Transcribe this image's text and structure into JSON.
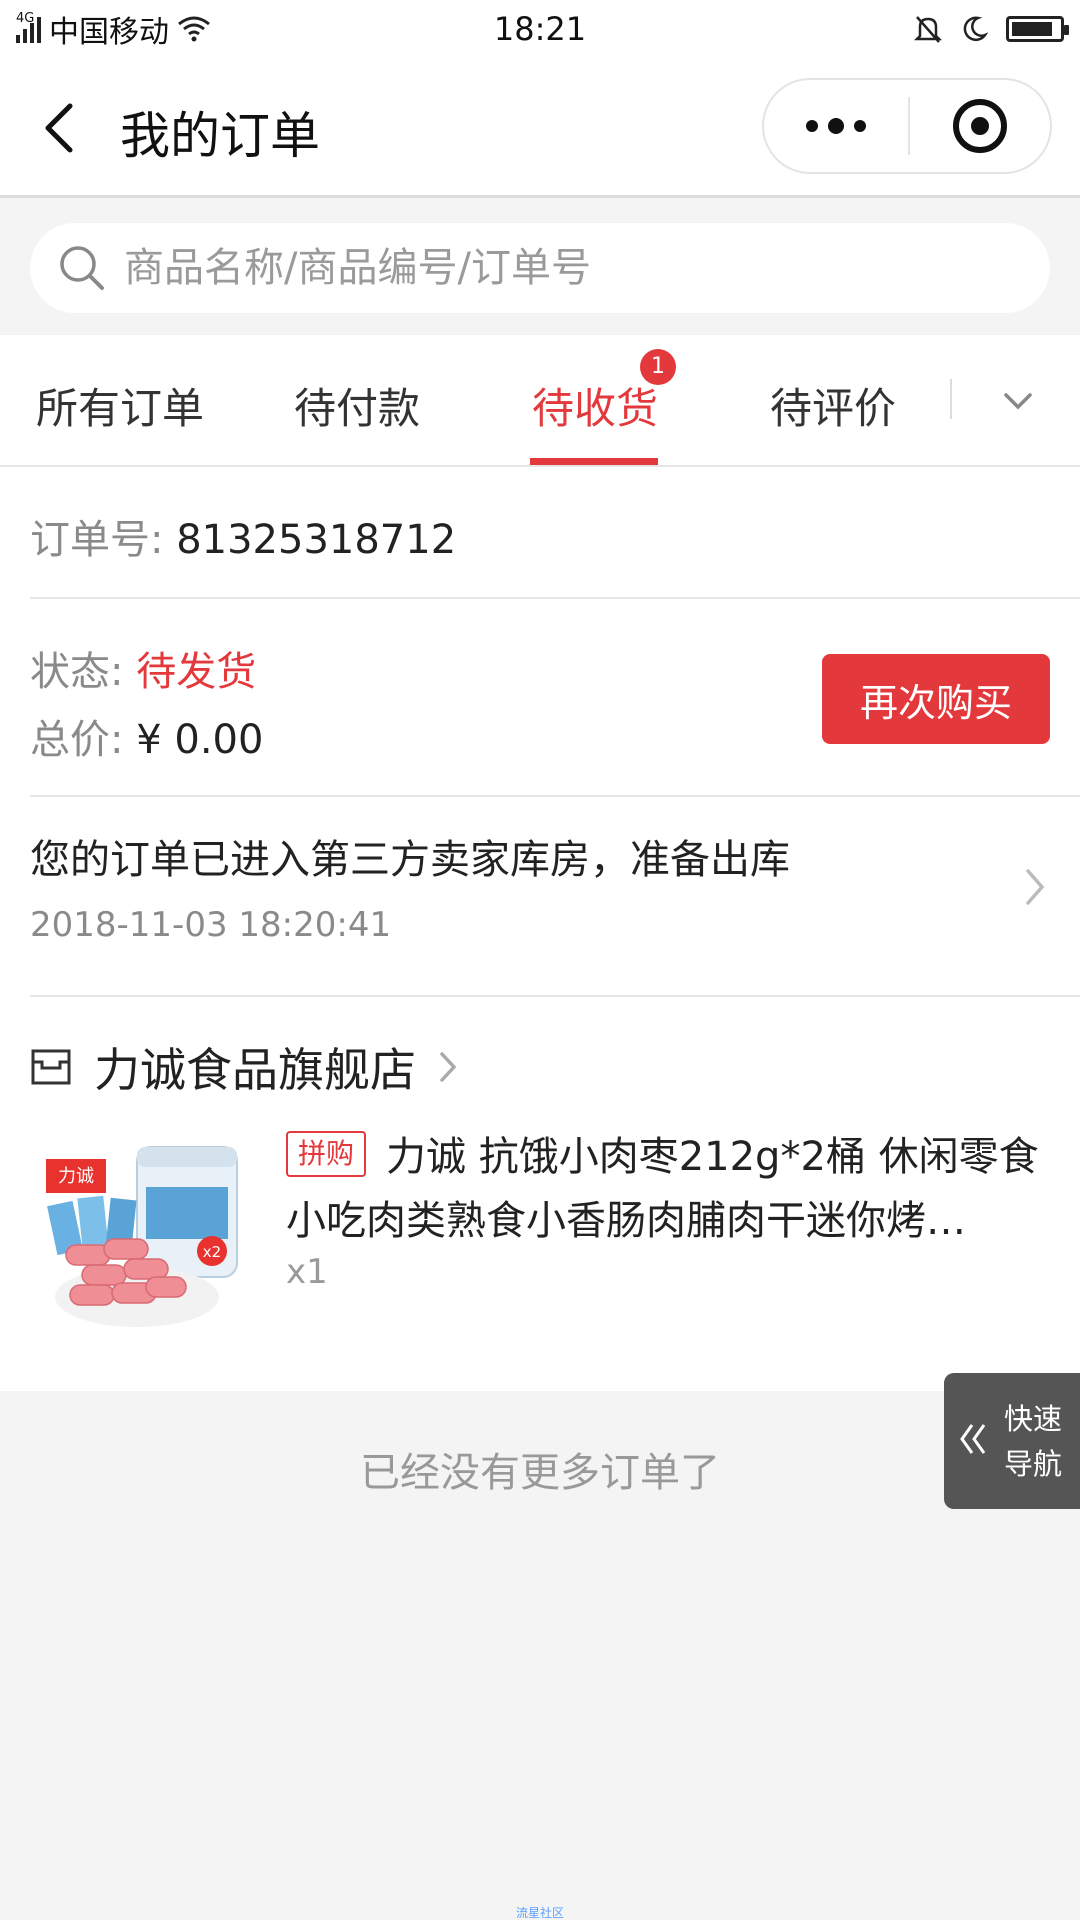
{
  "status_bar": {
    "network": "4G",
    "carrier": "中国移动",
    "time": "18:21"
  },
  "header": {
    "title": "我的订单"
  },
  "search": {
    "placeholder": "商品名称/商品编号/订单号"
  },
  "tabs": [
    {
      "label": "所有订单"
    },
    {
      "label": "待付款"
    },
    {
      "label": "待收货",
      "badge": "1",
      "active": true
    },
    {
      "label": "待评价"
    }
  ],
  "order": {
    "number_label": "订单号:",
    "number": "81325318712",
    "status_label": "状态:",
    "status": "待发货",
    "total_label": "总价:",
    "total": "¥ 0.00",
    "buy_again_label": "再次购买",
    "logistics": {
      "message": "您的订单已进入第三方卖家库房，准备出库",
      "time": "2018-11-03 18:20:41"
    },
    "shop": {
      "name": "力诚食品旗舰店"
    },
    "product": {
      "tag": "拼购",
      "title": "力诚 抗饿小肉枣212g*2桶 休闲零食小吃肉类熟食小香肠肉脯肉干迷你烤…",
      "quantity": "x1",
      "image_brand_text": "力诚",
      "image_badge_text": "x2"
    }
  },
  "footer": {
    "no_more": "已经没有更多订单了"
  },
  "quick_nav": {
    "line1": "快速",
    "line2": "导航"
  },
  "watermark": "流星社区",
  "colors": {
    "accent": "#e4393c",
    "background": "#f4f4f4"
  }
}
